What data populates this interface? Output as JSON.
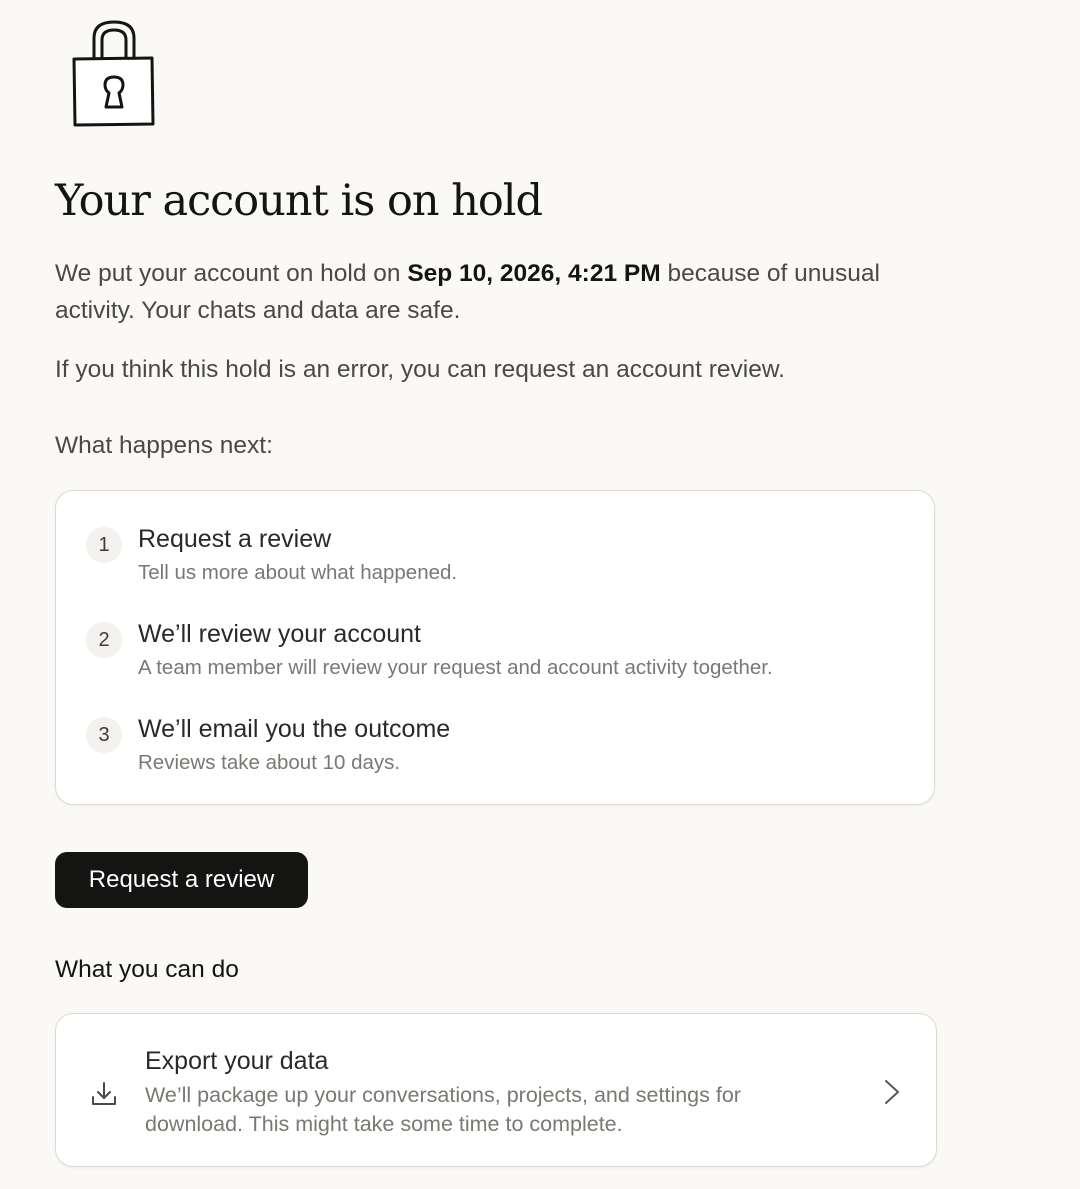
{
  "title": "Your account is on hold",
  "intro": {
    "prefix": "We put your account on hold on ",
    "date": "Sep 10, 2026, 4:21 PM",
    "suffix": " because of unusual activity. Your chats and data are safe."
  },
  "error_text": "If you think this hold is an error, you can request an account review.",
  "next_heading": "What happens next:",
  "steps": [
    {
      "number": "1",
      "title": "Request a review",
      "description": "Tell us more about what happened."
    },
    {
      "number": "2",
      "title": "We’ll review your account",
      "description": "A team member will review your request and account activity together."
    },
    {
      "number": "3",
      "title": "We’ll email you the outcome",
      "description": "Reviews take about 10 days."
    }
  ],
  "request_button_label": "Request a review",
  "can_do_heading": "What you can do",
  "export": {
    "title": "Export your data",
    "description": "We’ll package up your conversations, projects, and settings for download. This might take some time to complete.",
    "icon": "download-icon",
    "chevron_icon": "chevron-right-icon"
  },
  "lock_icon": "lock-icon"
}
